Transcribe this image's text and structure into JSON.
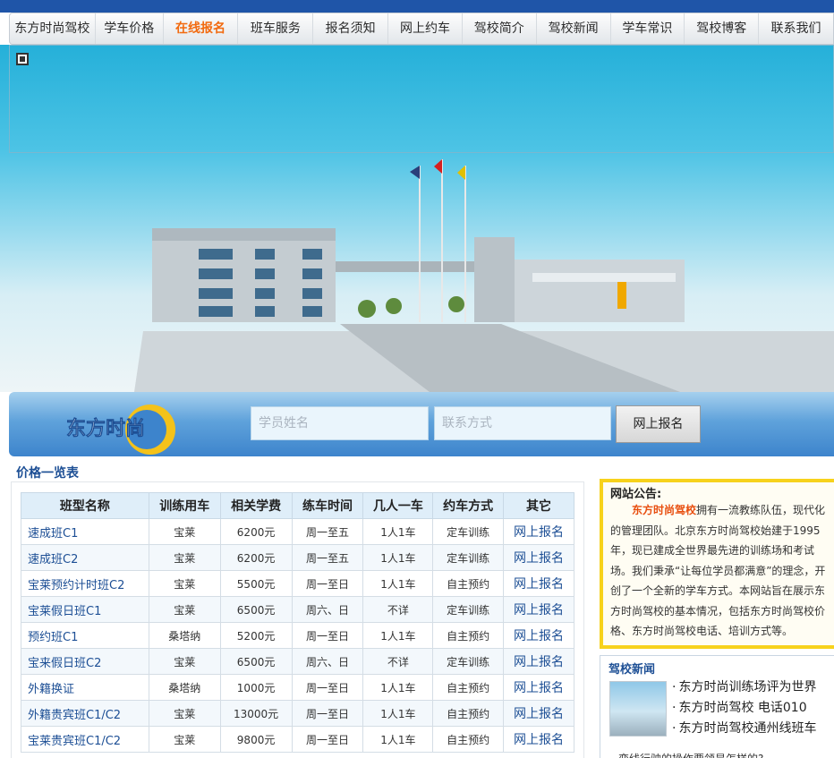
{
  "nav": {
    "items": [
      {
        "label": "东方时尚驾校"
      },
      {
        "label": "学车价格"
      },
      {
        "label": "在线报名",
        "active": true
      },
      {
        "label": "班车服务"
      },
      {
        "label": "报名须知"
      },
      {
        "label": "网上约车"
      },
      {
        "label": "驾校简介"
      },
      {
        "label": "驾校新闻"
      },
      {
        "label": "学车常识"
      },
      {
        "label": "驾校博客"
      },
      {
        "label": "联系我们"
      }
    ]
  },
  "registration": {
    "name_placeholder": "学员姓名",
    "contact_placeholder": "联系方式",
    "submit_label": "网上报名"
  },
  "price_section": {
    "title": "价格一览表",
    "headers": [
      "班型名称",
      "训练用车",
      "相关学费",
      "练车时间",
      "几人一车",
      "约车方式",
      "其它"
    ],
    "rows": [
      [
        "速成班C1",
        "宝莱",
        "6200元",
        "周一至五",
        "1人1车",
        "定车训练",
        "网上报名"
      ],
      [
        "速成班C2",
        "宝莱",
        "6200元",
        "周一至五",
        "1人1车",
        "定车训练",
        "网上报名"
      ],
      [
        "宝莱预约计时班C2",
        "宝莱",
        "5500元",
        "周一至日",
        "1人1车",
        "自主预约",
        "网上报名"
      ],
      [
        "宝莱假日班C1",
        "宝莱",
        "6500元",
        "周六、日",
        "不详",
        "定车训练",
        "网上报名"
      ],
      [
        "预约班C1",
        "桑塔纳",
        "5200元",
        "周一至日",
        "1人1车",
        "自主预约",
        "网上报名"
      ],
      [
        "宝来假日班C2",
        "宝莱",
        "6500元",
        "周六、日",
        "不详",
        "定车训练",
        "网上报名"
      ],
      [
        "外籍换证",
        "桑塔纳",
        "1000元",
        "周一至日",
        "1人1车",
        "自主预约",
        "网上报名"
      ],
      [
        "外籍贵宾班C1/C2",
        "宝莱",
        "13000元",
        "周一至日",
        "1人1车",
        "自主预约",
        "网上报名"
      ],
      [
        "宝莱贵宾班C1/C2",
        "宝莱",
        "9800元",
        "周一至日",
        "1人1车",
        "自主预约",
        "网上报名"
      ]
    ]
  },
  "notice": {
    "title": "网站公告:",
    "highlight": "东方时尚驾校",
    "body": "拥有一流教练队伍，现代化的管理团队。北京东方时尚驾校始建于1995年，现已建成全世界最先进的训练场和考试场。我们秉承“让每位学员都满意”的理念，开创了一个全新的学车方式。本网站旨在展示东方时尚驾校的基本情况，包括东方时尚驾校价格、东方时尚驾校电话、培训方式等。"
  },
  "news": {
    "title": "驾校新闻",
    "items": [
      "东方时尚训练场评为世界",
      "东方时尚驾校 电话010",
      "东方时尚驾校通州线班车"
    ],
    "more_text": "变线行驶的操作要领是怎样的?"
  },
  "colors": {
    "nav_active": "#f26a0f",
    "link_blue": "#1d4f95",
    "notice_border": "#f7d21c",
    "notice_highlight": "#e84e0f"
  }
}
